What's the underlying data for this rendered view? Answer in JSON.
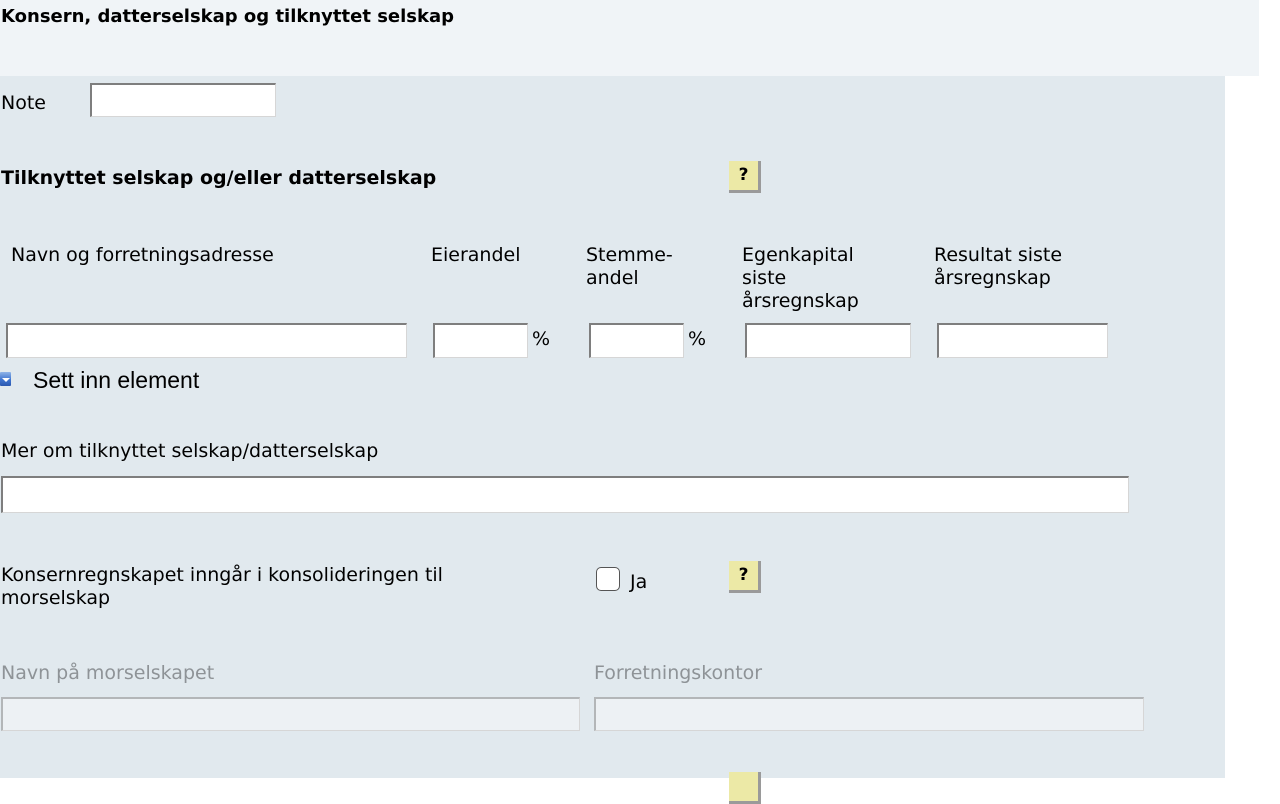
{
  "page": {
    "title": "Konsern, datterselskap og tilknyttet selskap"
  },
  "note": {
    "label": "Note",
    "value": ""
  },
  "associated": {
    "heading": "Tilknyttet selskap og/eller datterselskap",
    "help_label": "?",
    "columns": [
      {
        "label": "Navn og forretningsadresse"
      },
      {
        "label": "Eierandel"
      },
      {
        "label": "Stemme-\nandel"
      },
      {
        "label": "Egenkapital\nsiste\nårsregnskap"
      },
      {
        "label": "Resultat siste\nårsregnskap"
      }
    ],
    "row": {
      "name": "",
      "ownership_pct": "",
      "voting_pct": "",
      "equity": "",
      "result": ""
    },
    "percent_symbol": "%",
    "insert_label": "Sett inn element",
    "icons": {
      "insert": "insert-element-icon",
      "help": "help-icon"
    }
  },
  "more_info": {
    "label": "Mer om tilknyttet selskap/datterselskap",
    "value": ""
  },
  "consolidation": {
    "label": "Konsernregnskapet inngår i konsolideringen til\nmorselskap",
    "checkbox_label": "Ja",
    "checked": false,
    "help_label": "?"
  },
  "parent": {
    "name_label": "Navn på morselskapet",
    "name_value": "",
    "office_label": "Forretningskontor",
    "office_value": ""
  },
  "colors": {
    "header_bg": "#f0f4f7",
    "form_bg": "#e1e9ee",
    "help_bg": "#ece9a6",
    "disabled_text": "#8e9397"
  }
}
